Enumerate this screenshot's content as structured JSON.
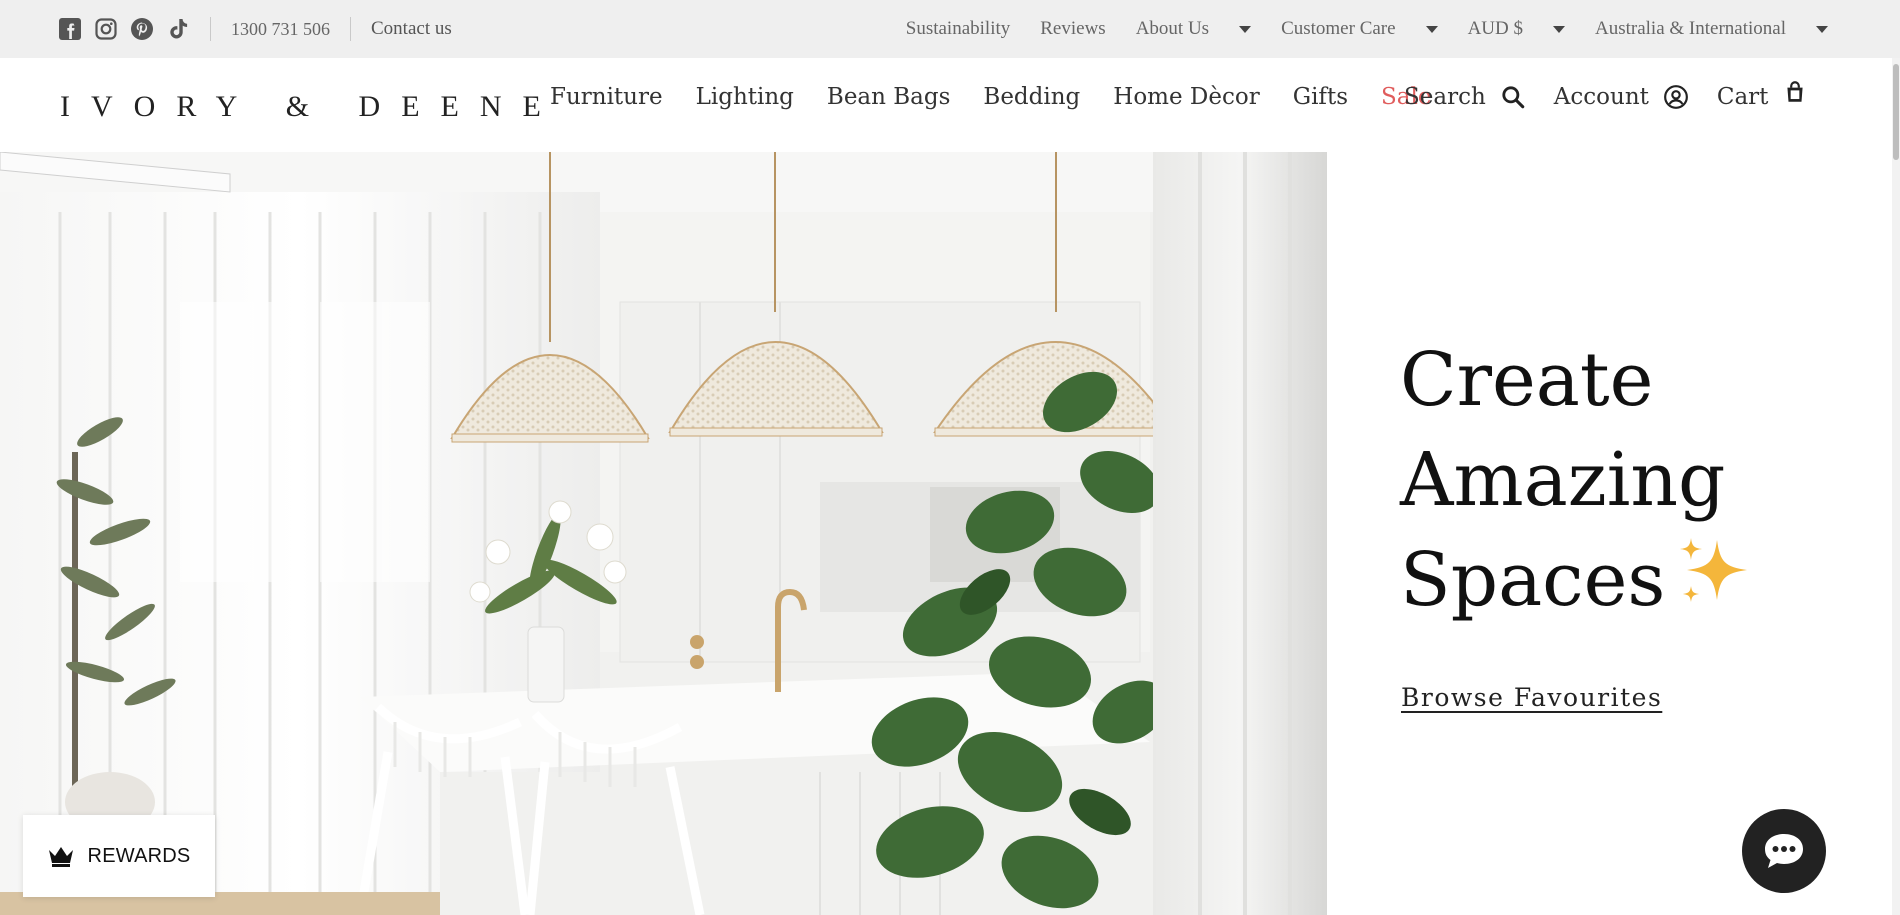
{
  "topbar": {
    "social_icons": [
      "facebook-icon",
      "instagram-icon",
      "pinterest-icon",
      "tiktok-icon"
    ],
    "phone": "1300 731 506",
    "contact": "Contact us",
    "links": {
      "sustainability": "Sustainability",
      "reviews": "Reviews",
      "about": "About Us",
      "customer_care": "Customer Care",
      "currency": "AUD $",
      "region": "Australia & International"
    }
  },
  "header": {
    "logo": "IVORY & DEENE",
    "nav": {
      "furniture": "Furniture",
      "lighting": "Lighting",
      "bean_bags": "Bean Bags",
      "bedding": "Bedding",
      "home_decor": "Home Dècor",
      "gifts": "Gifts",
      "sale": "Sale"
    },
    "search": "Search",
    "account": "Account",
    "cart": "Cart"
  },
  "hero": {
    "headline_line1": "Create",
    "headline_line2": "Amazing",
    "headline_line3": "Spaces",
    "cta": "Browse Favourites"
  },
  "widgets": {
    "rewards": "REWARDS",
    "chat_icon": "chat-bubble-icon"
  },
  "colors": {
    "topbar_bg": "#efefef",
    "sale": "#e05c5c",
    "sparkle": "#f4b63b",
    "chat_bg": "#222222"
  }
}
